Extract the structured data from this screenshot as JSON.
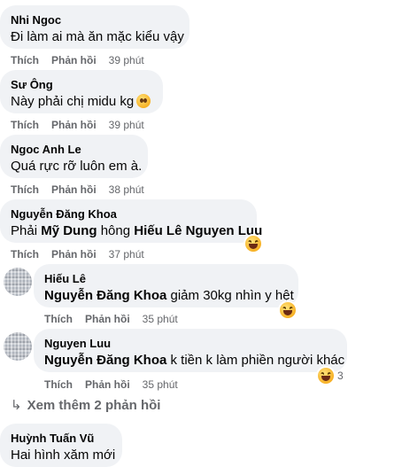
{
  "actions": {
    "like": "Thích",
    "reply": "Phản hồi"
  },
  "comments": [
    {
      "author": "Nhi Ngoc",
      "text": "Đi làm ai mà ăn mặc kiểu vậy",
      "time": "39 phút"
    },
    {
      "author": "Sư Ông",
      "text": "Này phải chị midu kg",
      "time": "39 phút",
      "icon": "sad-face-emoji"
    },
    {
      "author": "Ngoc Anh Le",
      "text": "Quá rực rỡ luôn em à.",
      "time": "38 phút"
    },
    {
      "author": "Nguyễn Đăng Khoa",
      "text_parts": [
        "Phải ",
        "Mỹ Dung",
        " hông ",
        "Hiếu Lê Nguyen Luu"
      ],
      "time": "37 phút",
      "reaction": "haha"
    }
  ],
  "replies": [
    {
      "author": "Hiếu Lê",
      "mention": "Nguyễn Đăng Khoa",
      "text": " giảm 30kg nhìn y hệt",
      "time": "35 phút",
      "reaction": "haha"
    },
    {
      "author": "Nguyen Luu",
      "mention": "Nguyễn Đăng Khoa",
      "text": " k tiền k làm phiền người khác",
      "time": "35 phút",
      "reaction": "haha",
      "reaction_count": "3"
    }
  ],
  "more_replies": "Xem thêm 2 phản hồi",
  "last_comment": {
    "author": "Huỳnh Tuấn Vũ",
    "text": "Hai hình xăm mới"
  }
}
